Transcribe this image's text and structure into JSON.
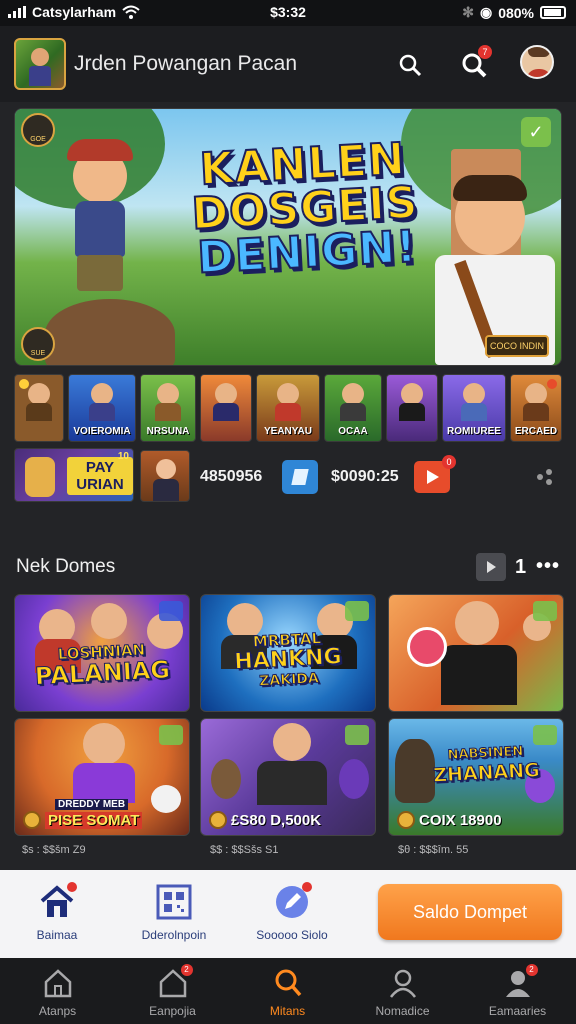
{
  "status_bar": {
    "carrier": "Catsylarham",
    "time": "$3:32",
    "battery": "080%"
  },
  "header": {
    "title": "Jrden Powangan Pacan",
    "notification_count": "7"
  },
  "hero": {
    "title_lines": [
      "KANLEN",
      "DOSGEIS",
      "DENIGN!"
    ],
    "badge_top": "GOE",
    "badge_bottom": "SUE",
    "tag": "COCO INDIN"
  },
  "thumbnails": [
    {
      "caption": "",
      "bg": "#8a5a2b"
    },
    {
      "caption": "VOIEROMIA",
      "bg": "#2a62c4"
    },
    {
      "caption": "NRSUNA",
      "bg": "#5f9a3a"
    },
    {
      "caption": "",
      "bg": "#d66a2a"
    },
    {
      "caption": "YEANYAU",
      "bg": "#9a5a2a"
    },
    {
      "caption": "OCAA",
      "bg": "#3d7a2a"
    },
    {
      "caption": "",
      "bg": "#6a3a9a"
    },
    {
      "caption": "ROMIUREE",
      "bg": "#7a55c8"
    },
    {
      "caption": "ERCAED",
      "bg": "#b8602a"
    }
  ],
  "promo": {
    "label_line1": "PAY",
    "label_line2": "URIAN",
    "number": "10"
  },
  "stats": {
    "value1": "4850956",
    "value2": "$0090:25",
    "play_badge": "0"
  },
  "section": {
    "title": "Nek Domes",
    "page": "1"
  },
  "cards": [
    {
      "title_line1": "LOSHNIAN",
      "title_line2": "PALANIAG",
      "bg1": "#7a3fd1",
      "bg2": "#e07a2a",
      "price": "",
      "sub": ""
    },
    {
      "title_line1": "MRBTAL",
      "title_line2": "HANKNG",
      "title_line3": "ZAKIDA",
      "bg1": "#1e6fbf",
      "bg2": "#3ab0e8",
      "price": "",
      "sub": ""
    },
    {
      "title_line1": "",
      "title_line2": "",
      "bg1": "#e07a2a",
      "bg2": "#c8402a",
      "price": "",
      "sub": ""
    },
    {
      "title_line1": "",
      "title_line2": "",
      "tag": "DREDDY MEB",
      "bg1": "#d86a2a",
      "bg2": "#8a3a1a",
      "price": "PISE SOMAT",
      "sub": "$s : $$šm Z9"
    },
    {
      "title_line1": "",
      "title_line2": "",
      "bg1": "#6a3a9a",
      "bg2": "#3a2a6a",
      "price": "£S80 D,500K",
      "sub": "$$ : $$Sšs S1"
    },
    {
      "title_line1": "NABSINEN",
      "title_line2": "ZHANANG",
      "bg1": "#3a8ac8",
      "bg2": "#2a6a3a",
      "price": "COIX 18900",
      "sub": "$θ : $$$îm. 55"
    }
  ],
  "action_bar": {
    "home_label": "Baimaa",
    "scan_label": "Dderolnpoin",
    "edit_label": "Sooooo Siolo",
    "cta_label": "Saldo Dompet"
  },
  "bottom_nav": [
    {
      "label": "Atanps",
      "icon": "home-icon"
    },
    {
      "label": "Eanpojia",
      "icon": "store-icon",
      "badge": "2"
    },
    {
      "label": "Mitans",
      "icon": "search-icon",
      "active": true
    },
    {
      "label": "Nomadice",
      "icon": "profile-icon"
    },
    {
      "label": "Eamaaries",
      "icon": "account-icon",
      "badge": "2"
    }
  ],
  "colors": {
    "accent": "#ff8a1f",
    "cta": "#f0781e",
    "background": "#232427"
  }
}
